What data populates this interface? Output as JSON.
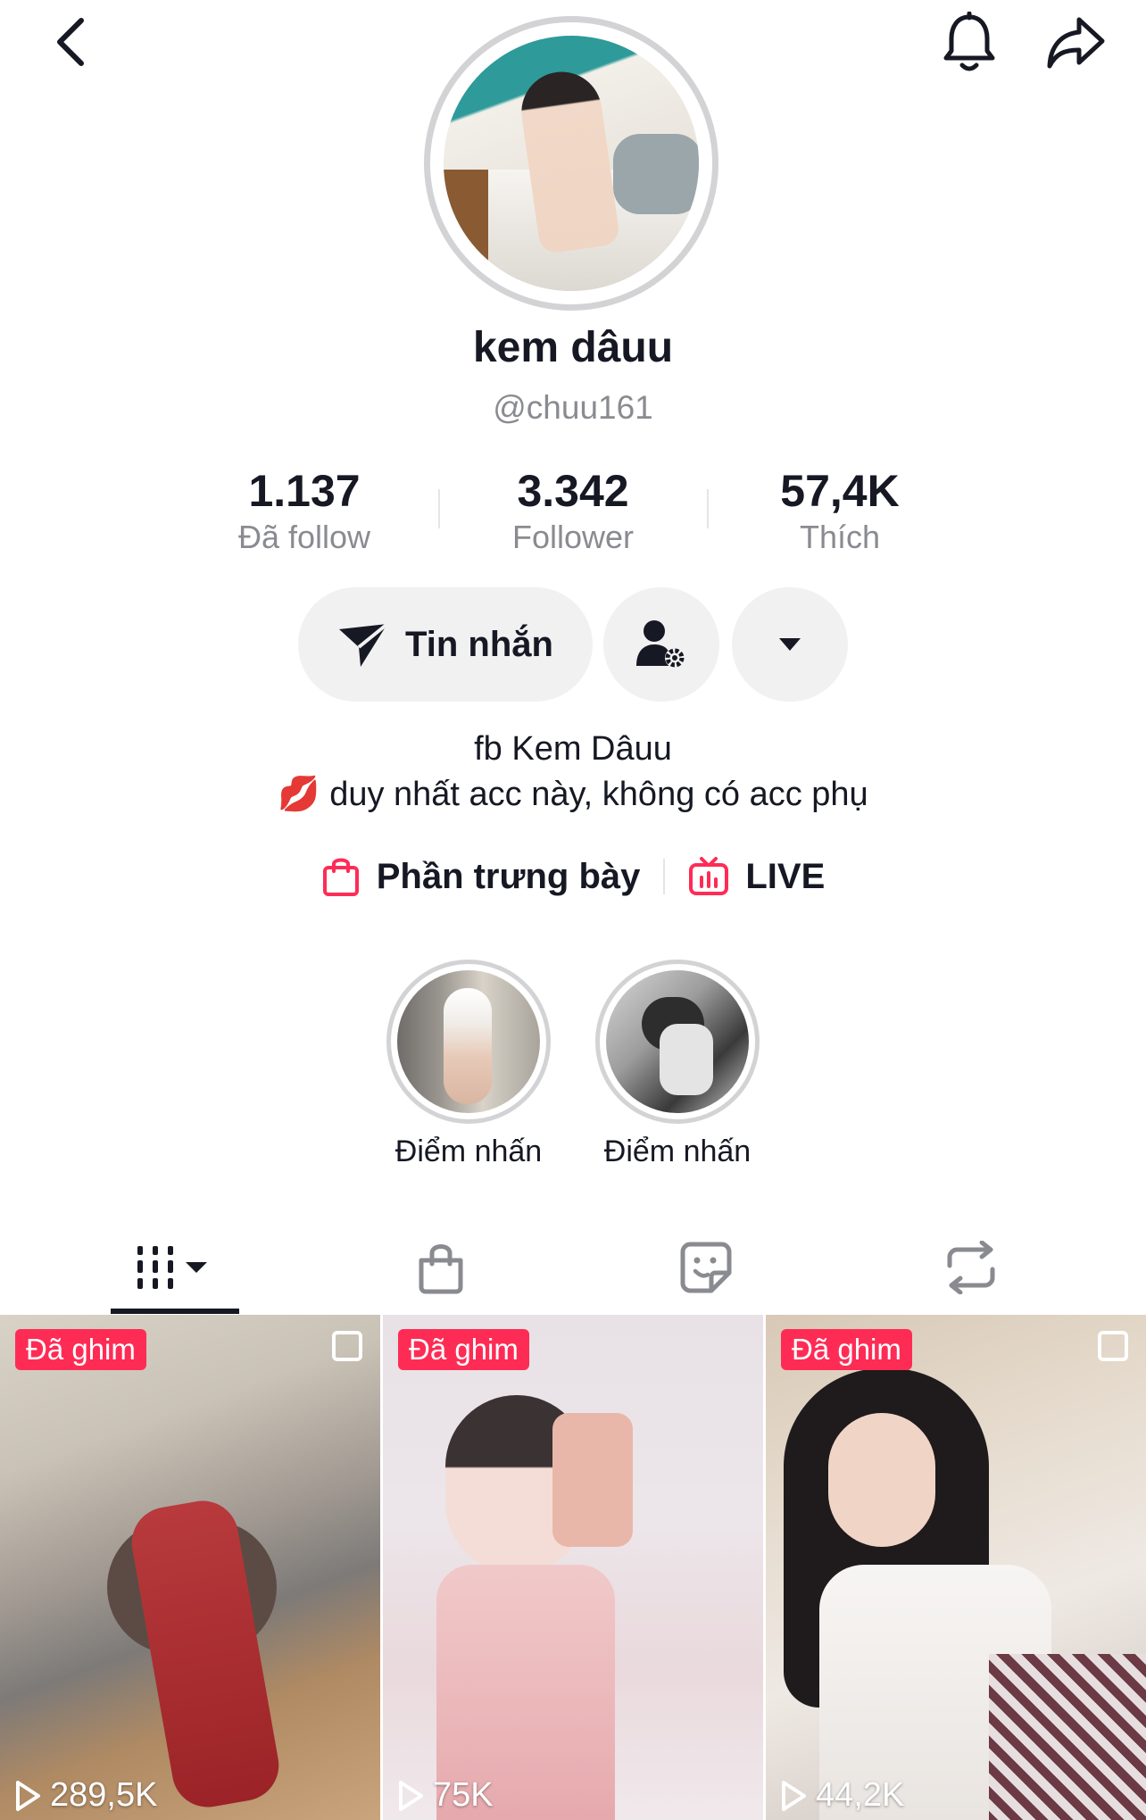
{
  "header": {
    "back_icon": "chevron-left-icon",
    "bell_icon": "bell-icon",
    "share_icon": "share-arrow-icon"
  },
  "profile": {
    "display_name": "kem dâuu",
    "handle": "@chuu161"
  },
  "stats": [
    {
      "value": "1.137",
      "label": "Đã follow"
    },
    {
      "value": "3.342",
      "label": "Follower"
    },
    {
      "value": "57,4K",
      "label": "Thích"
    }
  ],
  "actions": {
    "message_label": "Tin nhắn",
    "message_icon": "send-icon",
    "friend_settings_icon": "user-settings-icon",
    "more_icon": "caret-down-icon"
  },
  "bio": {
    "line1": "fb Kem Dâuu",
    "line2_emoji": "💋",
    "line2": "duy nhất acc này, không có acc phụ"
  },
  "links": [
    {
      "label": "Phần trưng bày",
      "icon": "shopping-bag-icon"
    },
    {
      "label": "LIVE",
      "icon": "live-tv-icon"
    }
  ],
  "highlights": [
    {
      "label": "Điểm nhấn"
    },
    {
      "label": "Điểm nhấn"
    }
  ],
  "tabs": [
    {
      "name": "videos",
      "icon": "grid-sort-icon",
      "active": true
    },
    {
      "name": "shop",
      "icon": "bag-icon",
      "active": false
    },
    {
      "name": "stickers",
      "icon": "sticker-icon",
      "active": false
    },
    {
      "name": "reposts",
      "icon": "repost-icon",
      "active": false
    }
  ],
  "videos": [
    {
      "pinned_label": "Đã ghim",
      "views": "289,5K"
    },
    {
      "pinned_label": "Đã ghim",
      "views": "75K"
    },
    {
      "pinned_label": "Đã ghim",
      "views": "44,2K"
    }
  ],
  "colors": {
    "accent": "#fe2c55",
    "text": "#161823",
    "secondary_text": "#8a8b91",
    "button_bg": "#f1f1f2"
  }
}
